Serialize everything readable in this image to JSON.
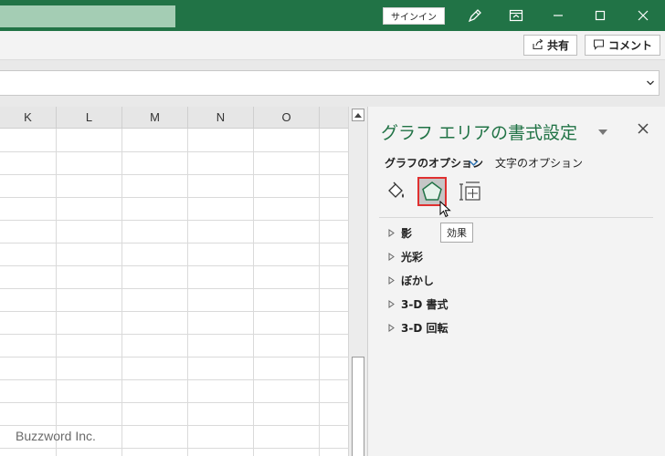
{
  "titlebar": {
    "signin_label": "サインイン",
    "icons": [
      "pen-icon",
      "ribbon-display-icon",
      "minimize-icon",
      "maximize-icon",
      "close-icon"
    ]
  },
  "ribbon": {
    "share_label": "共有",
    "comment_label": "コメント"
  },
  "grid": {
    "columns": [
      "K",
      "L",
      "M",
      "N",
      "O"
    ]
  },
  "watermark": "Buzzword Inc.",
  "pane": {
    "title": "グラフ エリアの書式設定",
    "tabs": {
      "chart_options": "グラフのオプション",
      "text_options": "文字のオプション"
    },
    "option_icons": [
      "fill-line-icon",
      "effects-icon",
      "size-properties-icon"
    ],
    "tooltip": "効果",
    "sections": [
      "影",
      "光彩",
      "ぼかし",
      "3-D 書式",
      "3-D 回転"
    ]
  },
  "colors": {
    "brand_green": "#217346",
    "selection_red": "#e03030"
  }
}
